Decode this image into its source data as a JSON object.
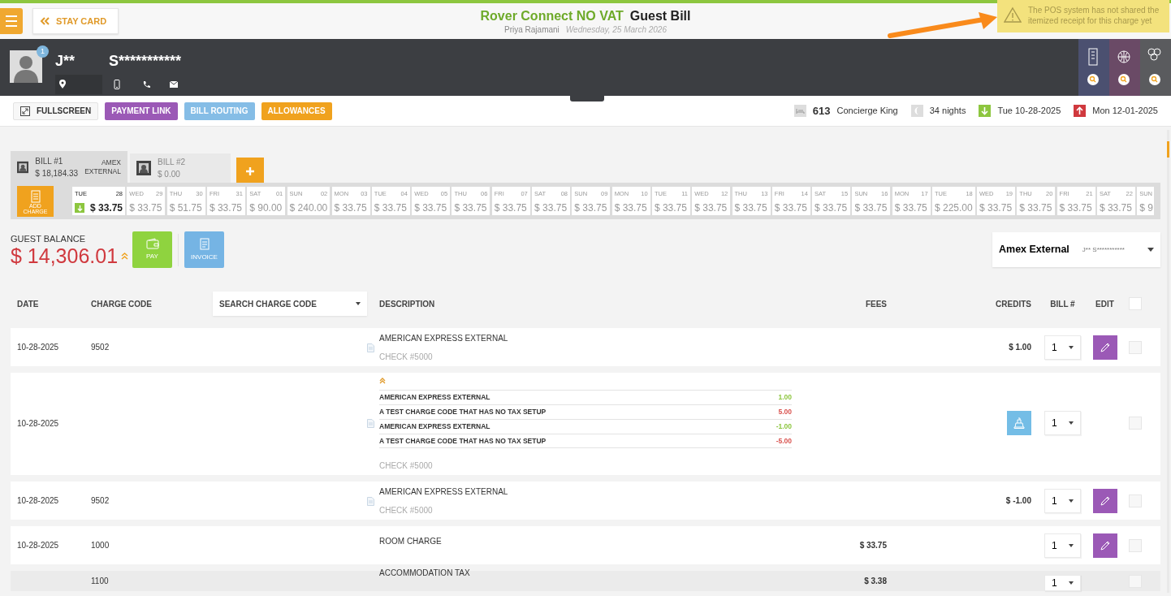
{
  "header": {
    "back_button": "STAY CARD",
    "property": "Rover Connect NO VAT",
    "title": "Guest Bill",
    "user": "Priya Rajamani",
    "date": "Wednesday, 25 March 2026"
  },
  "notice": {
    "text": "The POS system has not shared the itemized receipt for this charge yet"
  },
  "guest": {
    "first_name": "J**",
    "last_name": "S***********",
    "badge": "1"
  },
  "actions": [
    {
      "label": "FULLSCREEN",
      "kind": "fullscreen"
    },
    {
      "label": "PAYMENT LINK",
      "kind": "colored",
      "color": "#9b59b6"
    },
    {
      "label": "BILL ROUTING",
      "kind": "colored",
      "color": "#85bde6"
    },
    {
      "label": "ALLOWANCES",
      "kind": "colored",
      "color": "#f0a21e"
    }
  ],
  "stay": {
    "room": "613",
    "room_type": "Concierge King",
    "nights": "34 nights",
    "arrival": "Tue 10-28-2025",
    "departure": "Mon 12-01-2025"
  },
  "bills": [
    {
      "label": "BILL #1",
      "amount": "$ 18,184.33",
      "payer": "AMEX EXTERNAL",
      "selected": true
    },
    {
      "label": "BILL #2",
      "amount": "$ 0.00",
      "selected": false
    }
  ],
  "add_charge": "ADD CHARGE",
  "days": [
    {
      "day": "TUE",
      "date": "28",
      "amount": "$ 33.75",
      "selected": true
    },
    {
      "day": "WED",
      "date": "29",
      "amount": "$ 33.75",
      "selected": false
    },
    {
      "day": "THU",
      "date": "30",
      "amount": "$ 51.75",
      "selected": false
    },
    {
      "day": "FRI",
      "date": "31",
      "amount": "$ 33.75",
      "selected": false
    },
    {
      "day": "SAT",
      "date": "01",
      "amount": "$ 90.00",
      "selected": false
    },
    {
      "day": "SUN",
      "date": "02",
      "amount": "$ 240.00",
      "selected": false
    },
    {
      "day": "MON",
      "date": "03",
      "amount": "$ 33.75",
      "selected": false
    },
    {
      "day": "TUE",
      "date": "04",
      "amount": "$ 33.75",
      "selected": false
    },
    {
      "day": "WED",
      "date": "05",
      "amount": "$ 33.75",
      "selected": false
    },
    {
      "day": "THU",
      "date": "06",
      "amount": "$ 33.75",
      "selected": false
    },
    {
      "day": "FRI",
      "date": "07",
      "amount": "$ 33.75",
      "selected": false
    },
    {
      "day": "SAT",
      "date": "08",
      "amount": "$ 33.75",
      "selected": false
    },
    {
      "day": "SUN",
      "date": "09",
      "amount": "$ 33.75",
      "selected": false
    },
    {
      "day": "MON",
      "date": "10",
      "amount": "$ 33.75",
      "selected": false
    },
    {
      "day": "TUE",
      "date": "11",
      "amount": "$ 33.75",
      "selected": false
    },
    {
      "day": "WED",
      "date": "12",
      "amount": "$ 33.75",
      "selected": false
    },
    {
      "day": "THU",
      "date": "13",
      "amount": "$ 33.75",
      "selected": false
    },
    {
      "day": "FRI",
      "date": "14",
      "amount": "$ 33.75",
      "selected": false
    },
    {
      "day": "SAT",
      "date": "15",
      "amount": "$ 33.75",
      "selected": false
    },
    {
      "day": "SUN",
      "date": "16",
      "amount": "$ 33.75",
      "selected": false
    },
    {
      "day": "MON",
      "date": "17",
      "amount": "$ 33.75",
      "selected": false
    },
    {
      "day": "TUE",
      "date": "18",
      "amount": "$ 225.00",
      "selected": false
    },
    {
      "day": "WED",
      "date": "19",
      "amount": "$ 33.75",
      "selected": false
    },
    {
      "day": "THU",
      "date": "20",
      "amount": "$ 33.75",
      "selected": false
    },
    {
      "day": "FRI",
      "date": "21",
      "amount": "$ 33.75",
      "selected": false
    },
    {
      "day": "SAT",
      "date": "22",
      "amount": "$ 33.75",
      "selected": false
    },
    {
      "day": "SUN",
      "amount": "$ 9",
      "selected": false
    }
  ],
  "balance": {
    "label": "GUEST BALANCE",
    "amount": "$ 14,306.01"
  },
  "pay_button": "PAY",
  "invoice_button": "INVOICE",
  "routing": {
    "payer": "Amex External",
    "guest": "J** S***********"
  },
  "table": {
    "columns": [
      "DATE",
      "CHARGE CODE",
      "DESCRIPTION",
      "FEES",
      "CREDITS",
      "BILL #",
      "EDIT"
    ],
    "charge_code_filter": "SEARCH CHARGE CODE",
    "select_all": false,
    "rows": [
      {
        "date": "10-28-2025",
        "charge_code": "9502",
        "description": "AMERICAN EXPRESS EXTERNAL",
        "note": "CHECK #5000",
        "credits": "$ 1.00",
        "bill": "1",
        "attachment": true,
        "editable": true,
        "checked": false
      },
      {
        "date": "10-28-2025",
        "expanded": true,
        "details": [
          {
            "description": "AMERICAN EXPRESS EXTERNAL",
            "amount": "1.00",
            "color": "#8dc63f"
          },
          {
            "description": "A TEST CHARGE CODE THAT HAS NO TAX SETUP",
            "amount": "5.00",
            "color": "#d9534f"
          },
          {
            "description": "AMERICAN EXPRESS EXTERNAL",
            "amount": "-1.00",
            "color": "#8dc63f"
          },
          {
            "description": "A TEST CHARGE CODE THAT HAS NO TAX SETUP",
            "amount": "-5.00",
            "color": "#d9534f"
          }
        ],
        "note": "CHECK #5000",
        "receipt": true,
        "bill": "1",
        "attachment": true,
        "editable": false,
        "checked": false
      },
      {
        "date": "10-28-2025",
        "charge_code": "9502",
        "description": "AMERICAN EXPRESS EXTERNAL",
        "note": "CHECK #5000",
        "credits": "$ -1.00",
        "bill": "1",
        "attachment": true,
        "editable": true,
        "checked": false
      },
      {
        "date": "10-28-2025",
        "charge_code": "1000",
        "description": "ROOM CHARGE",
        "fees": "$ 33.75",
        "bill": "1",
        "attachment": false,
        "editable": true,
        "checked": false
      },
      {
        "charge_code": "1100",
        "description": "ACCOMMODATION TAX",
        "fees": "$ 3.38",
        "bill": "1",
        "attachment": false,
        "editable": false,
        "checked": false
      }
    ]
  }
}
